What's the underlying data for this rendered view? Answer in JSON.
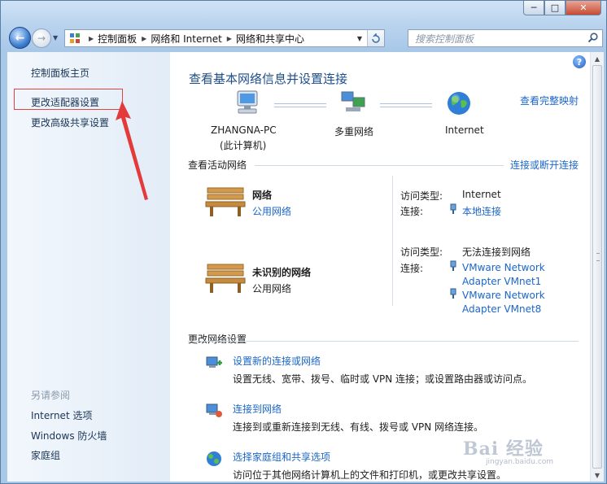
{
  "window": {
    "minimize_glyph": "─",
    "maximize_glyph": "□",
    "close_glyph": "✕"
  },
  "address": {
    "crumbs": [
      "控制面板",
      "网络和 Internet",
      "网络和共享中心"
    ],
    "search_placeholder": "搜索控制面板"
  },
  "sidebar": {
    "items": [
      "控制面板主页",
      "更改适配器设置",
      "更改高级共享设置"
    ],
    "see_also_label": "另请参阅",
    "see_also": [
      "Internet 选项",
      "Windows 防火墙",
      "家庭组"
    ]
  },
  "main": {
    "title": "查看基本网络信息并设置连接",
    "view_full_map": "查看完整映射",
    "map": {
      "computer_name": "ZHANGNA-PC",
      "computer_sub": "(此计算机)",
      "middle": "多重网络",
      "internet": "Internet"
    },
    "active_header": "查看活动网络",
    "connect_disconnect": "连接或断开连接",
    "networks": [
      {
        "name": "网络",
        "category": "公用网络",
        "access_label": "访问类型:",
        "access_value": "Internet",
        "conn_label": "连接:",
        "conns": [
          "本地连接"
        ]
      },
      {
        "name": "未识别的网络",
        "category": "公用网络",
        "access_label": "访问类型:",
        "access_value": "无法连接到网络",
        "conn_label": "连接:",
        "conns": [
          "VMware Network Adapter VMnet1",
          "VMware Network Adapter VMnet8"
        ],
        "conns_lines": [
          [
            "VMware Network",
            "Adapter VMnet1"
          ],
          [
            "VMware Network",
            "Adapter VMnet8"
          ]
        ]
      }
    ],
    "change_header": "更改网络设置",
    "tasks": [
      {
        "title": "设置新的连接或网络",
        "desc": "设置无线、宽带、拨号、临时或 VPN 连接；或设置路由器或访问点。"
      },
      {
        "title": "连接到网络",
        "desc": "连接到或重新连接到无线、有线、拨号或 VPN 网络连接。"
      },
      {
        "title": "选择家庭组和共享选项",
        "desc": "访问位于其他网络计算机上的文件和打印机，或更改共享设置。"
      }
    ]
  },
  "watermark": {
    "logo": "Bai 经验",
    "url": "jingyan.baidu.com"
  },
  "colors": {
    "link": "#1b66c9",
    "title": "#1e4d8c",
    "annotation": "#e04343"
  }
}
